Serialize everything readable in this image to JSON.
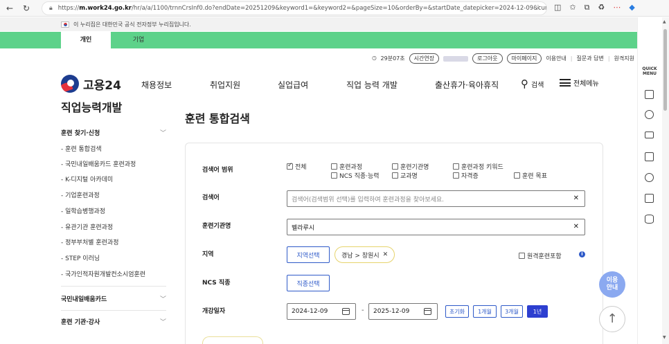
{
  "browser": {
    "url_host": "m.work24.go.kr",
    "url_path": "/hr/a/a/1100/trnnCrsInf0.do?endDate=20251209&keyword1=&keyword2=&pageSize=10&orderBy=&startDate_datepicker=2024-12-09&cur...",
    "url_prefix": "https://",
    "reader_label": "Aᴬ"
  },
  "gov_banner": {
    "text": "이 누리집은 대한민국 공식 전자정부 누리집입니다."
  },
  "tabs": [
    {
      "label": "개인"
    },
    {
      "label": "기업"
    }
  ],
  "util": {
    "timer": "29분07초",
    "extend": "시간연장",
    "logout": "로그아웃",
    "mypage": "마이페이지",
    "guide": "이용안내",
    "qna": "질문과 답변",
    "sitemap": "원격지원"
  },
  "header": {
    "logo_text": "고용24",
    "gnb": [
      "채용정보",
      "취업지원",
      "실업급여",
      "직업 능력 개발",
      "출산휴가·육아휴직"
    ],
    "search_label": "검색",
    "menu_label": "전체메뉴"
  },
  "sidebar": {
    "title": "직업능력개발",
    "section1": "훈련 찾기·신청",
    "items": [
      "- 훈련 통합검색",
      "- 국민내일배움카드 훈련과정",
      "- K-디지털 아카데미",
      "- 기업훈련과정",
      "- 일학습병행과정",
      "- 유관기관 훈련과정",
      "- 정부부처별 훈련과정",
      "- STEP 이러닝",
      "- 국가인적자원개발컨소시엄훈련"
    ],
    "section2": "국민내일배움카드",
    "section3": "훈련 기관·강사"
  },
  "content": {
    "title": "훈련 통합검색",
    "scope": {
      "label": "검색어 범위",
      "options": [
        {
          "label": "전체",
          "checked": true
        },
        {
          "label": "훈련과정",
          "checked": false
        },
        {
          "label": "훈련기관명",
          "checked": false
        },
        {
          "label": "훈련과정 키워드",
          "checked": false
        },
        {
          "label": "NCS 직종·능력",
          "checked": false
        },
        {
          "label": "교과명",
          "checked": false
        },
        {
          "label": "자격증",
          "checked": false
        },
        {
          "label": "훈련 목표",
          "checked": false
        }
      ]
    },
    "keyword": {
      "label": "검색어",
      "placeholder": "검색어(검색범위 선택)를 입력하여 훈련과정을 찾아보세요."
    },
    "institution": {
      "label": "훈련기관명",
      "value": "벨라루시"
    },
    "region": {
      "label": "지역",
      "button": "지역선택",
      "chip": "경남 > 창원시",
      "remote_label": "원격훈련포함",
      "info": "i"
    },
    "ncs": {
      "label": "NCS 직종",
      "button": "직종선택"
    },
    "date": {
      "label": "개강일자",
      "start": "2024-12-09",
      "end": "2025-12-09",
      "dash": "-",
      "presets": [
        "초기화",
        "1개월",
        "3개월",
        "1년"
      ],
      "active_preset": "1년"
    }
  },
  "quick_menu": {
    "label_line1": "QUICK",
    "label_line2": "MENU"
  },
  "floating": {
    "guide_line1": "이용",
    "guide_line2": "안내",
    "top_arrow": "↑"
  },
  "colors": {
    "green_bar": "#5dd28a",
    "primary_blue": "#2d59c8",
    "active_preset": "#2d3fd0",
    "chip_border": "#e6d36b",
    "guide_bubble": "#8ba9f0"
  }
}
